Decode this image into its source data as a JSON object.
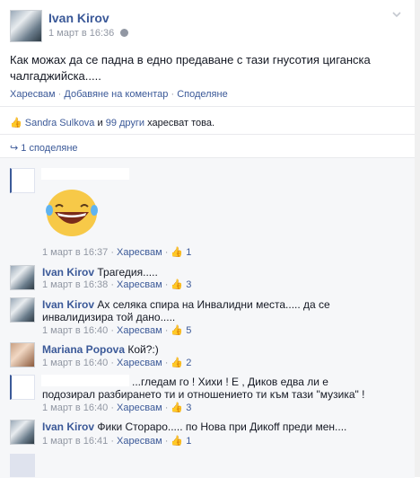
{
  "post": {
    "author": "Ivan Kirov",
    "time": "1 март в 16:36",
    "text": "Как можах да се падна в едно предаване с тази гнусотия циганска чалгаджийска.....",
    "actions": [
      "Харесвам",
      "Добавяне на коментар",
      "Споделяне"
    ],
    "likes_name": "Sandra Sulkova",
    "likes_and": "и",
    "likes_others": "99 други",
    "likes_suffix": "харесват това.",
    "shares": "1 споделяне"
  },
  "comments": [
    {
      "author": "",
      "text": "",
      "time": "1 март в 16:37",
      "like": "Харесвам",
      "count": "1"
    },
    {
      "author": "Ivan Kirov",
      "text": "Трагедия.....",
      "time": "1 март в 16:38",
      "like": "Харесвам",
      "count": "3"
    },
    {
      "author": "Ivan Kirov",
      "text": "Ах селяка спира на Инвалидни места..... да се инвалидизира той дано.....",
      "time": "1 март в 16:40",
      "like": "Харесвам",
      "count": "5"
    },
    {
      "author": "Mariana Popova",
      "text": "Кой?:)",
      "time": "1 март в 16:40",
      "like": "Харесвам",
      "count": "2"
    },
    {
      "author": "",
      "text": "...гледам го ! Хихи ! Е , Диков едва ли е подозирал разбирането ти и отношението ти към тази \"музика\" !",
      "time": "1 март в 16:40",
      "like": "Харесвам",
      "count": "3"
    },
    {
      "author": "Ivan Kirov",
      "text": "Фики Стораро..... по Нова при Дикоff преди мен....",
      "time": "1 март в 16:41",
      "like": "Харесвам",
      "count": "1"
    }
  ],
  "icons": {
    "globe": "globe-icon",
    "chevron": "chevron-down-icon",
    "like": "thumbs-up-icon",
    "share": "share-icon"
  },
  "colors": {
    "link": "#3b5998",
    "meta": "#9197a3",
    "emoji": "#f7c948"
  }
}
